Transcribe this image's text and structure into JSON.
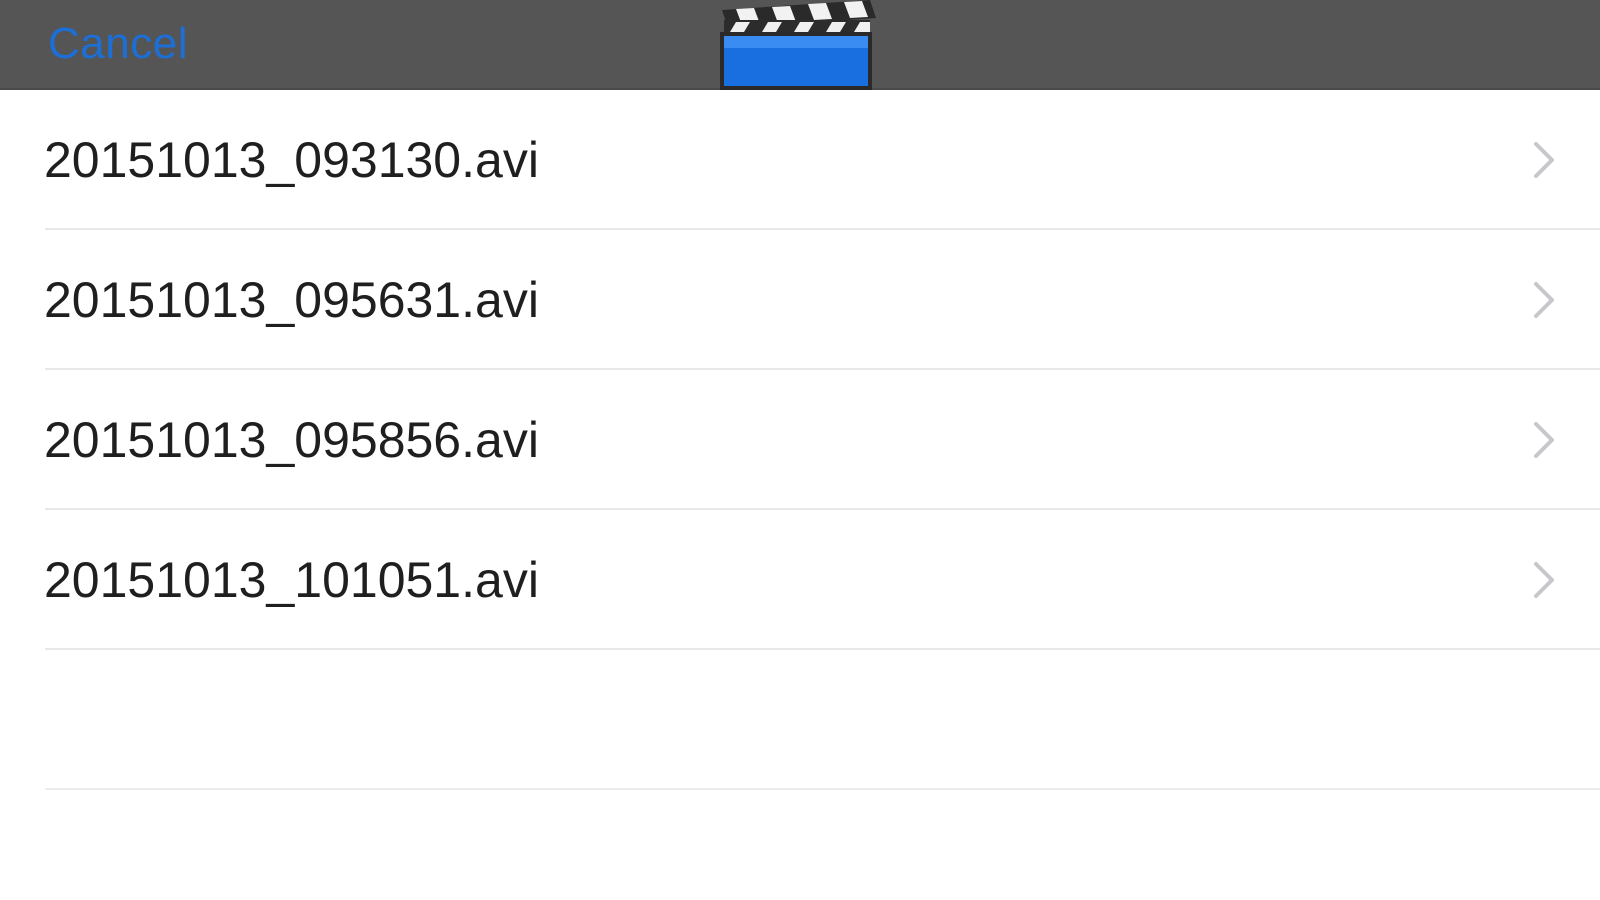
{
  "navbar": {
    "cancel_label": "Cancel",
    "logo_icon": "clapperboard-icon",
    "background": "#555555",
    "accent": "#1c6fd6"
  },
  "files": [
    {
      "name": "20151013_093130.avi"
    },
    {
      "name": "20151013_095631.avi"
    },
    {
      "name": "20151013_095856.avi"
    },
    {
      "name": "20151013_101051.avi"
    }
  ],
  "row_chevron_icon": "chevron-right-icon"
}
